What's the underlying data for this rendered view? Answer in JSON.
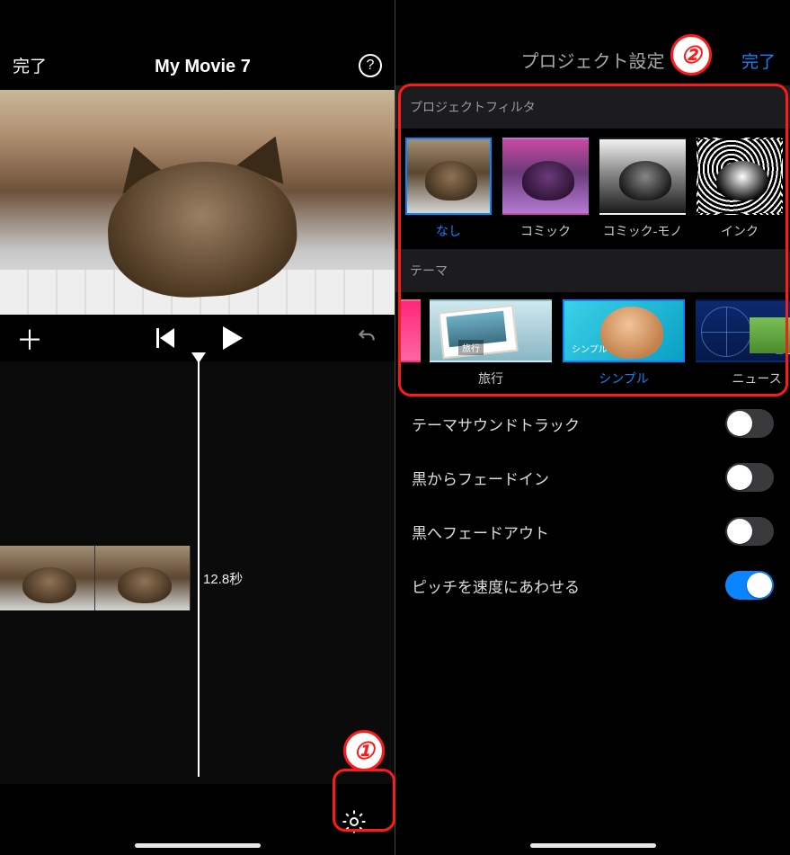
{
  "colors": {
    "accent": "#0a84ff",
    "annotation": "#ff1a1a"
  },
  "annotations": {
    "badge1": "①",
    "badge2": "②"
  },
  "left": {
    "done": "完了",
    "title": "My Movie 7",
    "help": "?",
    "clip_duration": "12.8秒"
  },
  "right": {
    "title": "プロジェクト設定",
    "done": "完了",
    "section_filter": "プロジェクトフィルタ",
    "filters": [
      {
        "label": "なし",
        "selected": true
      },
      {
        "label": "コミック",
        "selected": false
      },
      {
        "label": "コミック-モノ",
        "selected": false
      },
      {
        "label": "インク",
        "selected": false
      }
    ],
    "section_theme": "テーマ",
    "themes": {
      "travel": {
        "label": "旅行",
        "tag": "旅行",
        "selected": false
      },
      "simple": {
        "label": "シンプル",
        "tag": "シンプル",
        "selected": true
      },
      "news": {
        "label": "ニュース",
        "tag": "ニュース",
        "selected": false
      }
    },
    "settings": {
      "theme_soundtrack": {
        "label": "テーマサウンドトラック",
        "on": false
      },
      "fade_in_black": {
        "label": "黒からフェードイン",
        "on": false
      },
      "fade_out_black": {
        "label": "黒へフェードアウト",
        "on": false
      },
      "pitch_match_speed": {
        "label": "ピッチを速度にあわせる",
        "on": true
      }
    }
  }
}
